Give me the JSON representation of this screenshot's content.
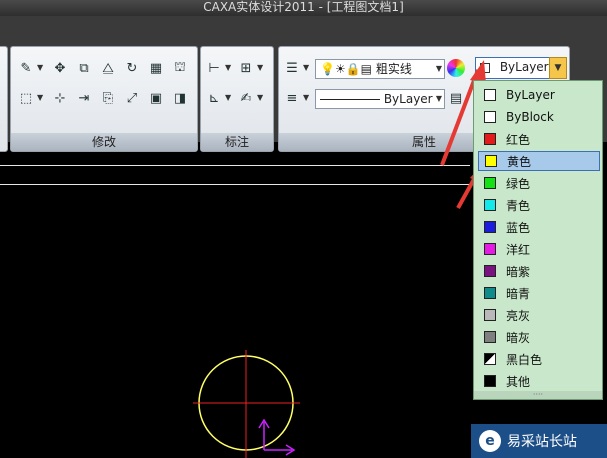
{
  "window": {
    "title": "CAXA实体设计2011 - [工程图文档1]"
  },
  "ribbon": {
    "panels": [
      {
        "label": "修改"
      },
      {
        "label": "标注"
      },
      {
        "label": "属性"
      }
    ],
    "linetype_combo": {
      "value": "粗实线"
    },
    "color_combo": {
      "value": "ByLayer"
    },
    "linestyle_combo": {
      "value": "ByLayer"
    }
  },
  "color_dropdown": {
    "selected_index": 3,
    "items": [
      {
        "label": "ByLayer",
        "color": "#ffffff"
      },
      {
        "label": "ByBlock",
        "color": "#ffffff"
      },
      {
        "label": "红色",
        "color": "#e31b1b"
      },
      {
        "label": "黄色",
        "color": "#ffff00"
      },
      {
        "label": "绿色",
        "color": "#16e016"
      },
      {
        "label": "青色",
        "color": "#13e9e9"
      },
      {
        "label": "蓝色",
        "color": "#1c1cdc"
      },
      {
        "label": "洋红",
        "color": "#e31be3"
      },
      {
        "label": "暗紫",
        "color": "#7a1281"
      },
      {
        "label": "暗青",
        "color": "#0f8b8b"
      },
      {
        "label": "亮灰",
        "color": "#b9b9b9"
      },
      {
        "label": "暗灰",
        "color": "#7f7f7f"
      },
      {
        "label": "黑白色",
        "color": "#000000"
      },
      {
        "label": "其他",
        "color": "#000000"
      }
    ]
  },
  "watermark": {
    "text": "易采站长站"
  }
}
